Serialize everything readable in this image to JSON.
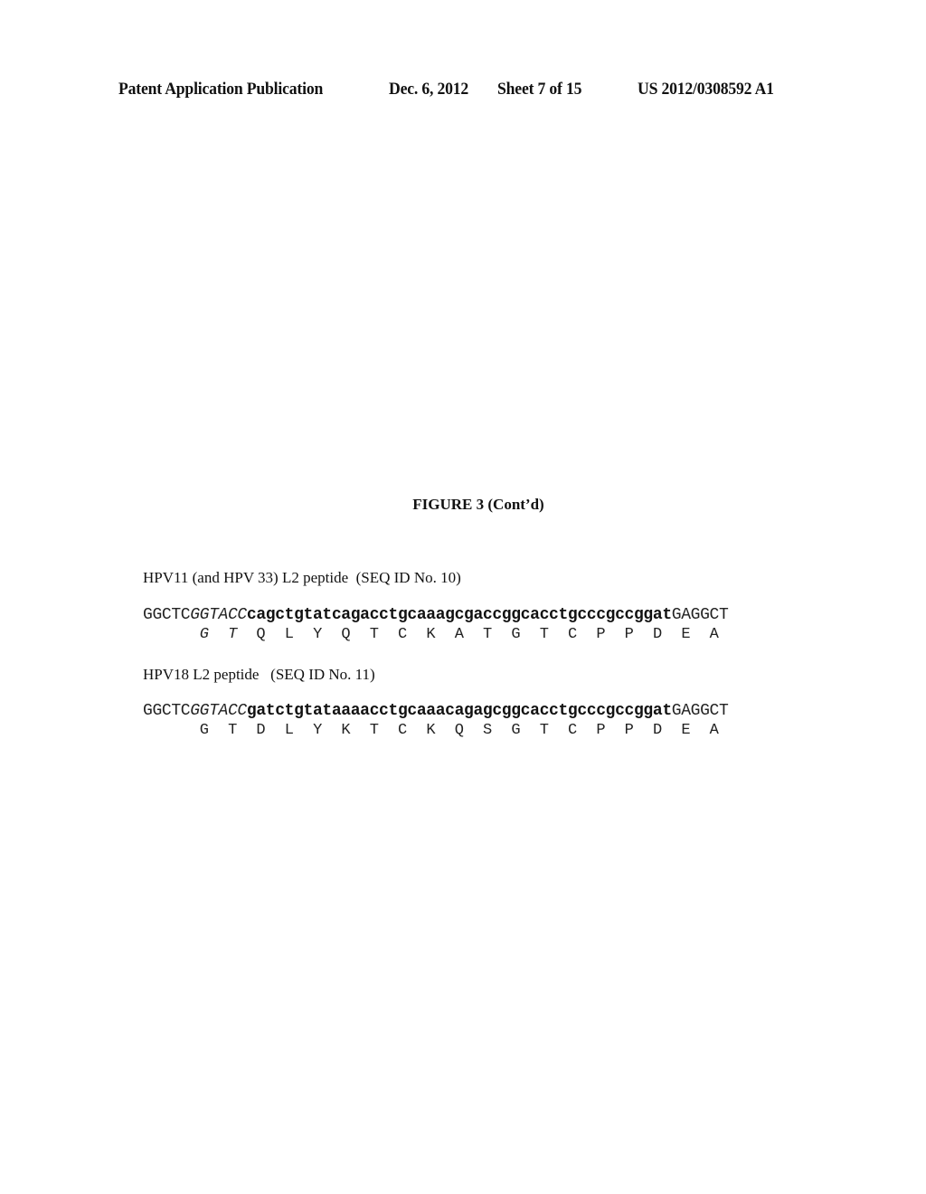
{
  "header": {
    "publication": "Patent Application Publication",
    "date": "Dec. 6, 2012",
    "sheet": "Sheet 7 of 15",
    "number": "US 2012/0308592 A1"
  },
  "figure": {
    "title": "FIGURE 3 (Cont’d)"
  },
  "sequences": [
    {
      "label": "HPV11 (and HPV 33) L2 peptide  (SEQ ID No. 10)",
      "dna": {
        "prefix": "GGCTC",
        "restriction_site": "GGTACC",
        "insert": "cagctgtatcagacctgcaaagcgaccggcacctgcccgccggat",
        "suffix": "GAGGCT"
      },
      "peptide": [
        "G",
        "T",
        "Q",
        "L",
        "Y",
        "Q",
        "T",
        "C",
        "K",
        "A",
        "T",
        "G",
        "T",
        "C",
        "P",
        "P",
        "D",
        "E",
        "A"
      ],
      "italic_residues": [
        0,
        1
      ]
    },
    {
      "label": "HPV18 L2 peptide   (SEQ ID No. 11)",
      "dna": {
        "prefix": "GGCTC",
        "restriction_site": "GGTACC",
        "insert": "gatctgtataaaacctgcaaacagagcggcacctgcccgccggat",
        "suffix": "GAGGCT"
      },
      "peptide": [
        "G",
        "T",
        "D",
        "L",
        "Y",
        "K",
        "T",
        "C",
        "K",
        "Q",
        "S",
        "G",
        "T",
        "C",
        "P",
        "P",
        "D",
        "E",
        "A"
      ],
      "italic_residues": []
    }
  ]
}
